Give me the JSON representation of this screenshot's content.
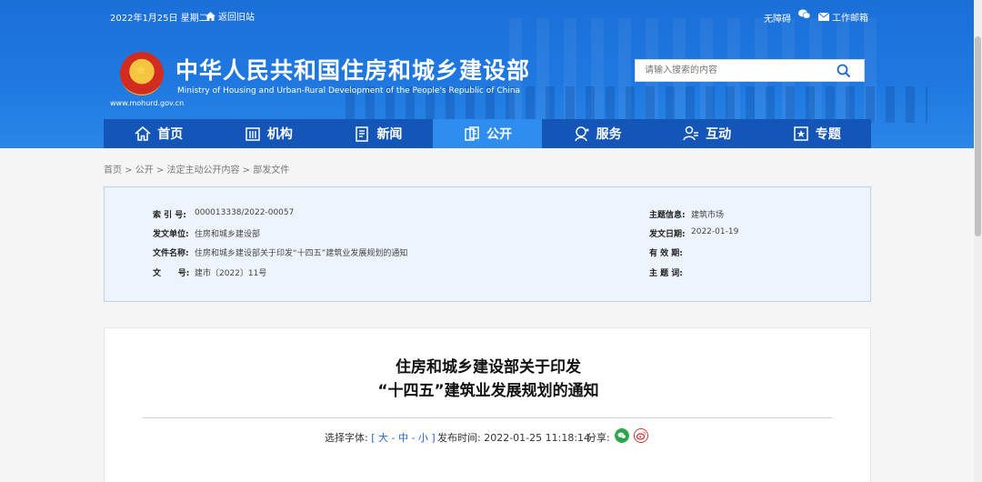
{
  "topbar": {
    "date": "2022年1月25日 星期二",
    "home_label": "返回旧站",
    "accessibility": "无障碍",
    "mail_label": "工作邮箱"
  },
  "brand": {
    "url": "www.mohurd.gov.cn",
    "title": "中华人民共和国住房和城乡建设部",
    "subtitle": "Ministry of Housing and Urban-Rural Development of the People's Republic of China"
  },
  "search": {
    "placeholder": "请输入搜索的内容"
  },
  "nav": {
    "items": [
      {
        "label": "首页",
        "icon": "home-icon"
      },
      {
        "label": "机构",
        "icon": "building-icon"
      },
      {
        "label": "新闻",
        "icon": "news-icon"
      },
      {
        "label": "公开",
        "icon": "open-icon",
        "active": true
      },
      {
        "label": "服务",
        "icon": "service-icon"
      },
      {
        "label": "互动",
        "icon": "interact-icon"
      },
      {
        "label": "专题",
        "icon": "topic-icon"
      }
    ]
  },
  "breadcrumb": "首页 > 公开 > 法定主动公开内容 > 部发文件",
  "info": {
    "index_label": "索 引 号:",
    "index_value": "000013338/2022-00057",
    "issuer_label": "发文单位:",
    "issuer_value": "住房和城乡建设部",
    "filename_label": "文件名称:",
    "filename_value": "住房和城乡建设部关于印发“十四五”建筑业发展规划的通知",
    "docno_label": "文      号:",
    "docno_value": "建市〔2022〕11号",
    "topic_label": "主题信息:",
    "topic_value": "建筑市场",
    "date_label": "发文日期:",
    "date_value": "2022-01-19",
    "validity_label": "有 效 期:",
    "validity_value": "",
    "keyword_label": "主 题 词:",
    "keyword_value": ""
  },
  "article": {
    "title_line1": "住房和城乡建设部关于印发",
    "title_line2": "“十四五”建筑业发展规划的通知",
    "font_select_label": "选择字体:",
    "font_select_options": "[ 大 - 中 - 小 ]",
    "publish_label": "发布时间:",
    "publish_time": "2022-01-25 11:18:14",
    "share_label": "分享:"
  },
  "colors": {
    "header_blue": "#1f78e0",
    "nav_blue": "#1356b8",
    "nav_active": "#2f8df0",
    "infobox_bg": "#eef4fb"
  }
}
